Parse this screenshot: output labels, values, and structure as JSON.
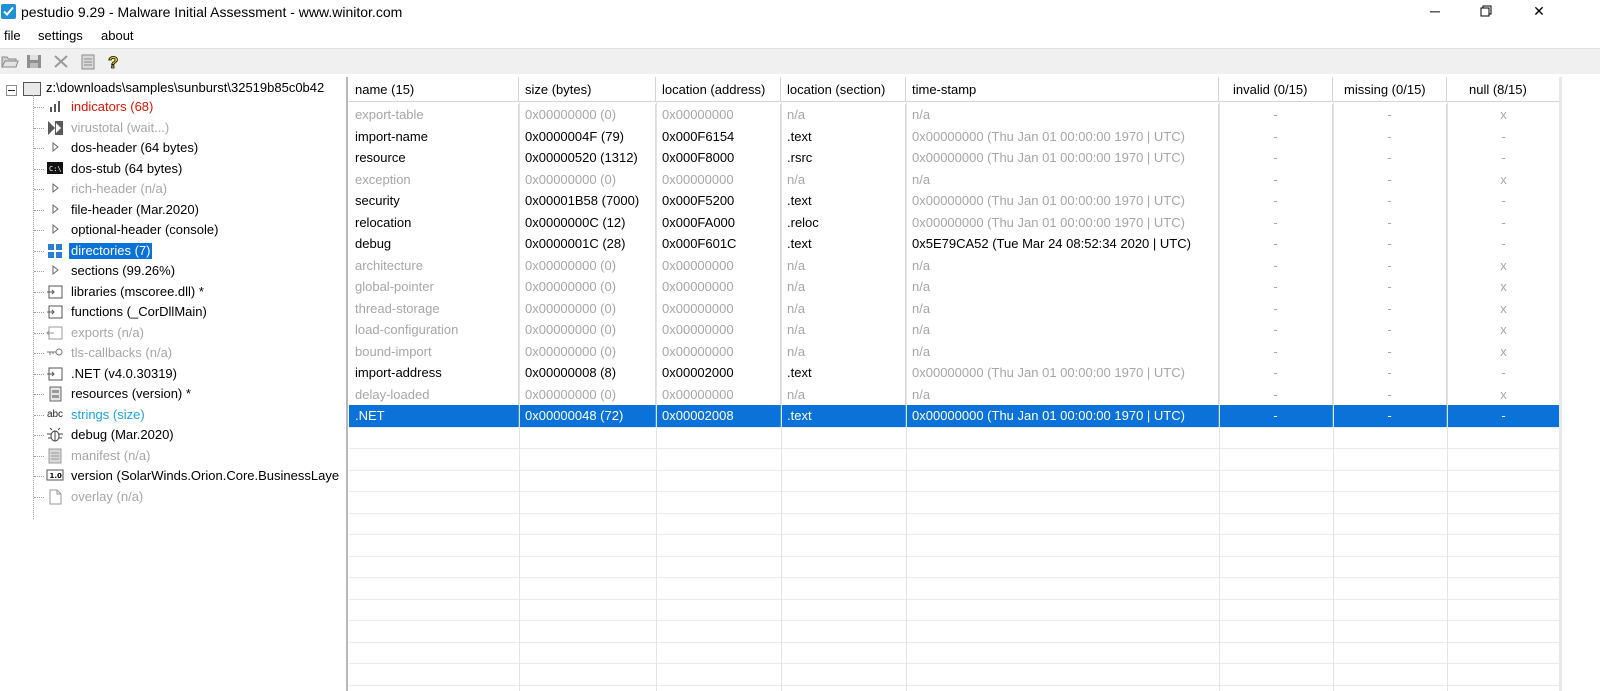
{
  "window": {
    "title": "pestudio 9.29 - Malware Initial Assessment - www.winitor.com",
    "minimize_glyph": "─",
    "close_glyph": "✕"
  },
  "menu": [
    "file",
    "settings",
    "about"
  ],
  "toolbar": {
    "icons": [
      "open-folder-icon",
      "save-icon",
      "delete-icon",
      "clipboard-icon",
      "help-icon"
    ]
  },
  "tree": {
    "root_label": "z:\\downloads\\samples\\sunburst\\32519b85c0b42",
    "items": [
      {
        "label": "indicators (68)",
        "icon": "bar-chart-icon",
        "style": "red"
      },
      {
        "label": "virustotal (wait...)",
        "icon": "virustotal-icon",
        "style": "gray"
      },
      {
        "label": "dos-header (64 bytes)",
        "icon": "triangle-right-icon",
        "style": "normal"
      },
      {
        "label": "dos-stub (64 bytes)",
        "icon": "console-icon",
        "style": "normal"
      },
      {
        "label": "rich-header (n/a)",
        "icon": "triangle-right-icon",
        "style": "gray"
      },
      {
        "label": "file-header (Mar.2020)",
        "icon": "triangle-right-icon",
        "style": "normal"
      },
      {
        "label": "optional-header (console)",
        "icon": "triangle-right-icon",
        "style": "normal"
      },
      {
        "label": "directories (7)",
        "icon": "grid-icon",
        "style": "selected"
      },
      {
        "label": "sections (99.26%)",
        "icon": "triangle-right-icon",
        "style": "normal"
      },
      {
        "label": "libraries (mscoree.dll) *",
        "icon": "library-icon",
        "style": "normal"
      },
      {
        "label": "functions (_CorDllMain)",
        "icon": "function-icon",
        "style": "normal"
      },
      {
        "label": "exports (n/a)",
        "icon": "export-icon",
        "style": "gray"
      },
      {
        "label": "tls-callbacks (n/a)",
        "icon": "key-icon",
        "style": "gray"
      },
      {
        "label": ".NET (v4.0.30319)",
        "icon": "dotnet-icon",
        "style": "normal"
      },
      {
        "label": "resources (version) *",
        "icon": "resources-icon",
        "style": "normal"
      },
      {
        "label": "strings (size)",
        "icon": "abc-icon",
        "style": "blue"
      },
      {
        "label": "debug (Mar.2020)",
        "icon": "bug-icon",
        "style": "normal"
      },
      {
        "label": "manifest (n/a)",
        "icon": "manifest-icon",
        "style": "gray"
      },
      {
        "label": "version (SolarWinds.Orion.Core.BusinessLaye",
        "icon": "version-icon",
        "style": "normal"
      },
      {
        "label": "overlay (n/a)",
        "icon": "document-icon",
        "style": "gray"
      }
    ],
    "abc_glyph": "abc",
    "version_glyph": "1.0",
    "console_glyph": "C:\\"
  },
  "table": {
    "columns": [
      "name  (15)",
      "size (bytes)",
      "location (address)",
      "location (section)",
      "time-stamp",
      "invalid  (0/15)",
      "missing  (0/15)",
      "null  (8/15)"
    ],
    "rows": [
      {
        "name": "export-table",
        "size": "0x00000000 (0)",
        "address": "0x00000000",
        "section": "n/a",
        "timestamp": "n/a",
        "invalid": "-",
        "missing": "-",
        "null": "x",
        "style": "gray"
      },
      {
        "name": "import-name",
        "size": "0x0000004F (79)",
        "address": "0x000F6154",
        "section": ".text",
        "timestamp": "0x00000000 (Thu Jan 01 00:00:00 1970 | UTC)",
        "invalid": "-",
        "missing": "-",
        "null": "-",
        "style": "normal",
        "ts_gray": true
      },
      {
        "name": "resource",
        "size": "0x00000520 (1312)",
        "address": "0x000F8000",
        "section": ".rsrc",
        "timestamp": "0x00000000 (Thu Jan 01 00:00:00 1970 | UTC)",
        "invalid": "-",
        "missing": "-",
        "null": "-",
        "style": "normal",
        "ts_gray": true
      },
      {
        "name": "exception",
        "size": "0x00000000 (0)",
        "address": "0x00000000",
        "section": "n/a",
        "timestamp": "n/a",
        "invalid": "-",
        "missing": "-",
        "null": "x",
        "style": "gray"
      },
      {
        "name": "security",
        "size": "0x00001B58 (7000)",
        "address": "0x000F5200",
        "section": ".text",
        "timestamp": "0x00000000 (Thu Jan 01 00:00:00 1970 | UTC)",
        "invalid": "-",
        "missing": "-",
        "null": "-",
        "style": "normal",
        "ts_gray": true
      },
      {
        "name": "relocation",
        "size": "0x0000000C (12)",
        "address": "0x000FA000",
        "section": ".reloc",
        "timestamp": "0x00000000 (Thu Jan 01 00:00:00 1970 | UTC)",
        "invalid": "-",
        "missing": "-",
        "null": "-",
        "style": "normal",
        "ts_gray": true
      },
      {
        "name": "debug",
        "size": "0x0000001C (28)",
        "address": "0x000F601C",
        "section": ".text",
        "timestamp": "0x5E79CA52 (Tue Mar 24 08:52:34 2020 | UTC)",
        "invalid": "-",
        "missing": "-",
        "null": "-",
        "style": "normal",
        "ts_gray": false
      },
      {
        "name": "architecture",
        "size": "0x00000000 (0)",
        "address": "0x00000000",
        "section": "n/a",
        "timestamp": "n/a",
        "invalid": "-",
        "missing": "-",
        "null": "x",
        "style": "gray"
      },
      {
        "name": "global-pointer",
        "size": "0x00000000 (0)",
        "address": "0x00000000",
        "section": "n/a",
        "timestamp": "n/a",
        "invalid": "-",
        "missing": "-",
        "null": "x",
        "style": "gray"
      },
      {
        "name": "thread-storage",
        "size": "0x00000000 (0)",
        "address": "0x00000000",
        "section": "n/a",
        "timestamp": "n/a",
        "invalid": "-",
        "missing": "-",
        "null": "x",
        "style": "gray"
      },
      {
        "name": "load-configuration",
        "size": "0x00000000 (0)",
        "address": "0x00000000",
        "section": "n/a",
        "timestamp": "n/a",
        "invalid": "-",
        "missing": "-",
        "null": "x",
        "style": "gray"
      },
      {
        "name": "bound-import",
        "size": "0x00000000 (0)",
        "address": "0x00000000",
        "section": "n/a",
        "timestamp": "n/a",
        "invalid": "-",
        "missing": "-",
        "null": "x",
        "style": "gray"
      },
      {
        "name": "import-address",
        "size": "0x00000008 (8)",
        "address": "0x00002000",
        "section": ".text",
        "timestamp": "0x00000000 (Thu Jan 01 00:00:00 1970 | UTC)",
        "invalid": "-",
        "missing": "-",
        "null": "-",
        "style": "normal",
        "ts_gray": true
      },
      {
        "name": "delay-loaded",
        "size": "0x00000000 (0)",
        "address": "0x00000000",
        "section": "n/a",
        "timestamp": "n/a",
        "invalid": "-",
        "missing": "-",
        "null": "x",
        "style": "gray"
      },
      {
        "name": ".NET",
        "size": "0x00000048 (72)",
        "address": "0x00002008",
        "section": ".text",
        "timestamp": "0x00000000 (Thu Jan 01 00:00:00 1970 | UTC)",
        "invalid": "-",
        "missing": "-",
        "null": "-",
        "style": "selected"
      }
    ]
  },
  "colors": {
    "selection": "#0a72d8",
    "gray_text": "#a6a6a6",
    "red_text": "#e51400",
    "blue_text": "#1aa3e8"
  }
}
